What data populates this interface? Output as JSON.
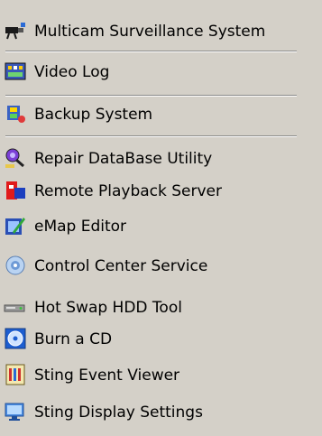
{
  "menu": {
    "items": [
      {
        "label": "Multicam Surveillance System",
        "icon": "surveillance-camera-icon"
      },
      {
        "label": "Video Log",
        "icon": "video-log-icon"
      },
      {
        "label": "Backup System",
        "icon": "backup-icon"
      },
      {
        "label": "Repair DataBase Utility",
        "icon": "repair-database-icon"
      },
      {
        "label": "Remote Playback Server",
        "icon": "remote-playback-icon"
      },
      {
        "label": "eMap Editor",
        "icon": "emap-editor-icon"
      },
      {
        "label": "Control Center Service",
        "icon": "control-center-icon"
      },
      {
        "label": "Hot Swap HDD Tool",
        "icon": "hdd-tool-icon"
      },
      {
        "label": "Burn a CD",
        "icon": "burn-cd-icon"
      },
      {
        "label": "Sting Event Viewer",
        "icon": "event-viewer-icon"
      },
      {
        "label": "Sting Display Settings",
        "icon": "display-settings-icon"
      }
    ]
  }
}
